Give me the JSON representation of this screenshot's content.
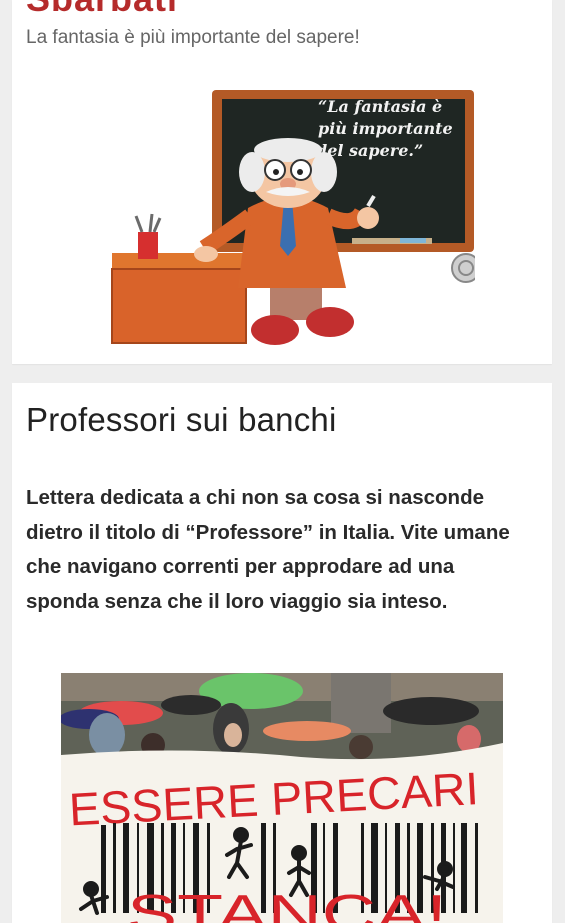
{
  "header": {
    "site_title": "Sbarbati",
    "tagline": "La fantasia è più importante del sapere!",
    "illustration": {
      "alt_icon": "professor-chalkboard-illustration",
      "chalkboard_lines": [
        "“La fantasia è",
        "più importante",
        "del sapere.”"
      ]
    }
  },
  "article": {
    "title": "Professori sui banchi",
    "excerpt": "Lettera dedicata a chi non sa cosa si nasconde dietro il titolo di “Professore” in Italia. Vite umane che navigano correnti per approdare ad una sponda senza che il loro viaggio sia inteso.",
    "photo": {
      "alt_icon": "protest-banner-photo",
      "banner_line1": "ESSERE PRECARI",
      "banner_line2": "STANCA!"
    }
  },
  "colors": {
    "site_title": "#b52b2b",
    "background": "#eeeeee",
    "card": "#ffffff",
    "banner_text": "#d8242a"
  }
}
